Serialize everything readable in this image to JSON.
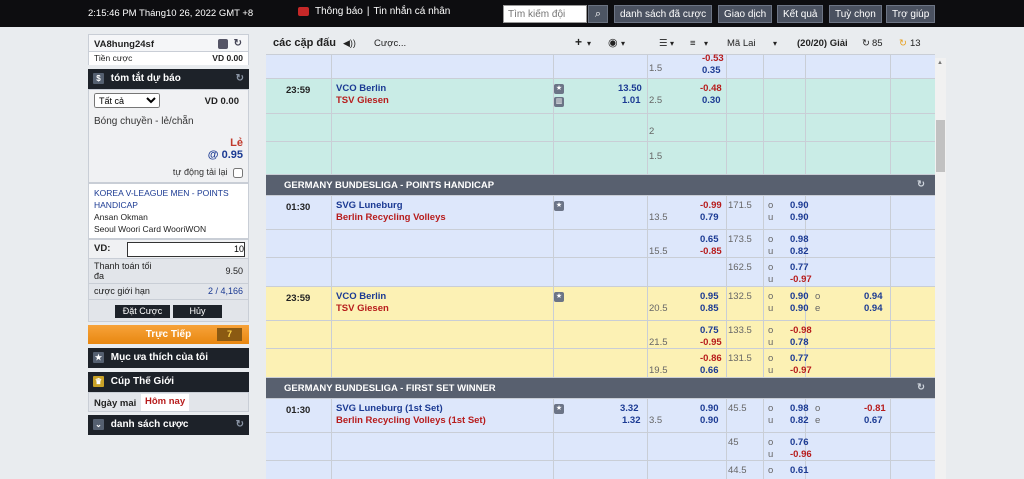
{
  "topbar": {
    "clock": "2:15:46 PM Tháng10 26, 2022 GMT +8",
    "notice": "Thông báo",
    "sep": "|",
    "messages": "Tin nhắn cá nhân",
    "search_placeholder": "Tìm kiếm đội",
    "buttons": [
      "danh sách đã cược",
      "Giao dịch",
      "Kết quả",
      "Tuỳ chọn",
      "Trợ giúp"
    ]
  },
  "account": {
    "username": "VA8hung24sf",
    "balance_label": "Tiền cược",
    "balance_value": "VD  0.00"
  },
  "betslip": {
    "title": "tóm tắt dự báo",
    "filter": "Tất cả",
    "amount": "VD 0.00",
    "sport_market": "Bóng chuyền - lẻ/chẵn",
    "selection": "Lẻ",
    "odds": "@ 0.95",
    "auto_accept": "tự động tải lại",
    "league": "KOREA V-LEAGUE MEN - POINTS HANDICAP",
    "team1": "Ansan Okman",
    "team2": "Seoul Woori Card WooriWON",
    "stake_label": "VD:",
    "stake_value": "10",
    "max_label": "Thanh toán tối đa",
    "max_value": "9.50",
    "limit_label": "cược giới hạn",
    "limit_value": "2 / 4,166",
    "place_btn": "Đặt Cược",
    "cancel_btn": "Hủy",
    "live_label": "Trực Tiếp",
    "live_count": "7"
  },
  "favorites": {
    "title": "Mục ưa thích của tôi"
  },
  "worldcup": {
    "title": "Cúp Thế Giới",
    "tab_tomorrow": "Ngày mai",
    "tab_today": "Hôm nay"
  },
  "mybets": {
    "title": "danh sách cược"
  },
  "main_header": {
    "title": "các cặp đấu",
    "bets": "Cược...",
    "odds_type": "Mã Lai",
    "count": "(20/20) Giải",
    "refresh": "85",
    "timer": "13"
  },
  "events": [
    {
      "time": "",
      "home": "",
      "away": "",
      "c1": "",
      "c2": "",
      "h1": "1.5",
      "o1": "-0.53",
      "o2": "0.35"
    },
    {
      "time": "23:59",
      "home": "VCO Berlin",
      "away": "TSV Giesen",
      "c1": "13.50",
      "c2": "1.01",
      "h1": "2.5",
      "o1": "-0.48",
      "o2": "0.30"
    },
    {
      "h1": "2"
    },
    {
      "h1": "1.5"
    }
  ],
  "group1": "GERMANY BUNDESLIGA - POINTS HANDICAP",
  "g1rows": [
    {
      "time": "01:30",
      "home": "SVG Luneburg",
      "away": "Berlin Recycling Volleys",
      "h": "13.5",
      "o1": "-0.99",
      "o2": "0.79",
      "t": "171.5",
      "u1": "o",
      "u2": "u",
      "p1": "0.90",
      "p2": "0.90"
    },
    {
      "h": "15.5",
      "o1": "0.65",
      "o2": "-0.85",
      "t": "173.5",
      "u1": "o",
      "u2": "u",
      "p1": "0.98",
      "p2": "0.82"
    },
    {
      "h": "",
      "o1": "",
      "o2": "",
      "t": "162.5",
      "u1": "o",
      "u2": "u",
      "p1": "0.77",
      "p2": "-0.97"
    }
  ],
  "g1hl": [
    {
      "time": "23:59",
      "home": "VCO Berlin",
      "away": "TSV Giesen",
      "h": "20.5",
      "o1": "0.95",
      "o2": "0.85",
      "t": "132.5",
      "u1": "o",
      "u2": "u",
      "p1": "0.90",
      "p2": "0.90",
      "e1": "o",
      "e2": "e",
      "q1": "0.94",
      "q2": "0.94"
    },
    {
      "h": "21.5",
      "o1": "0.75",
      "o2": "-0.95",
      "t": "133.5",
      "u1": "o",
      "u2": "u",
      "p1": "-0.98",
      "p2": "0.78"
    },
    {
      "h": "19.5",
      "o1": "-0.86",
      "o2": "0.66",
      "t": "131.5",
      "u1": "o",
      "u2": "u",
      "p1": "0.77",
      "p2": "-0.97"
    }
  ],
  "group2": "GERMANY BUNDESLIGA - FIRST SET WINNER",
  "g2rows": [
    {
      "time": "01:30",
      "home": "SVG Luneburg (1st Set)",
      "away": "Berlin Recycling Volleys (1st Set)",
      "c1": "3.32",
      "c2": "1.32",
      "h": "3.5",
      "o1": "0.90",
      "o2": "0.90",
      "t": "45.5",
      "u1": "o",
      "u2": "u",
      "p1": "0.98",
      "p2": "0.82",
      "e1": "o",
      "e2": "e",
      "q1": "-0.81",
      "q2": "0.67"
    },
    {
      "t": "45",
      "u1": "o",
      "u2": "u",
      "p1": "0.76",
      "p2": "-0.96"
    },
    {
      "t": "44.5",
      "u1": "o",
      "p1": "0.61"
    }
  ]
}
